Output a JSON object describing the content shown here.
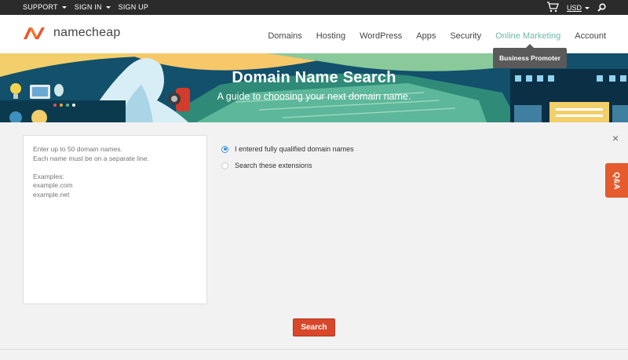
{
  "topbar": {
    "support": "SUPPORT",
    "sign_in": "SIGN IN",
    "sign_up": "SIGN UP",
    "currency": "USD"
  },
  "brand": {
    "name": "namecheap"
  },
  "nav": [
    {
      "label": "Domains"
    },
    {
      "label": "Hosting"
    },
    {
      "label": "WordPress"
    },
    {
      "label": "Apps"
    },
    {
      "label": "Security"
    },
    {
      "label": "Online Marketing"
    },
    {
      "label": "Account"
    }
  ],
  "nav_tooltip": "Business Promoter",
  "hero": {
    "title": "Domain Name Search",
    "subtitle": "A guide to choosing your next domain name."
  },
  "search": {
    "placeholder": "Enter up to 50 domain names.\nEach name must be on a separate line.\n\nExamples:\nexample.com\nexample.net",
    "options": [
      {
        "label": "I entered fully qualified domain names",
        "selected": true
      },
      {
        "label": "Search these extensions",
        "selected": false
      }
    ],
    "button_label": "Search",
    "close_glyph": "×"
  },
  "qa_tab": "Q&A",
  "colors": {
    "accent": "#d9472b",
    "active_nav": "#6fb8a7",
    "radio": "#3b8de0",
    "qa": "#e55b2d"
  }
}
